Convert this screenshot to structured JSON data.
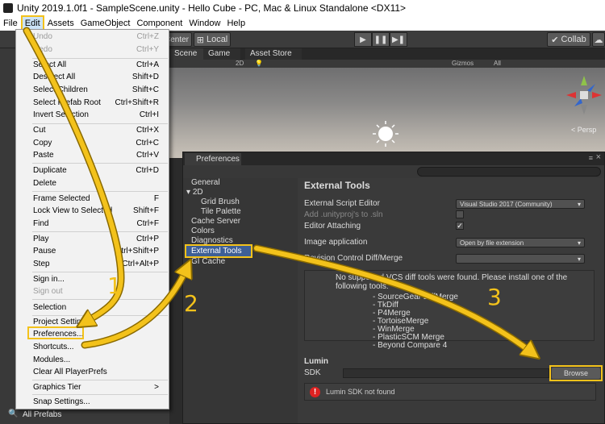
{
  "window": {
    "title": "Unity 2019.1.0f1 - SampleScene.unity - Hello Cube - PC, Mac & Linux Standalone <DX11>"
  },
  "menubar": [
    "File",
    "Edit",
    "Assets",
    "GameObject",
    "Component",
    "Window",
    "Help"
  ],
  "toolbar": {
    "center_label": "Center",
    "local_label": "Local",
    "collab_label": "Collab"
  },
  "scene_tabs": {
    "scene": "Scene",
    "game": "Game",
    "asset_store": "Asset Store"
  },
  "scene_options": {
    "mode": "2D",
    "gizmos": "Gizmos",
    "search": "All",
    "persp": "Persp"
  },
  "edit_menu": {
    "items": [
      {
        "label": "Undo",
        "shortcut": "Ctrl+Z",
        "disabled": true
      },
      {
        "label": "Redo",
        "shortcut": "Ctrl+Y",
        "disabled": true
      },
      {
        "label": "Select All",
        "shortcut": "Ctrl+A"
      },
      {
        "label": "Deselect All",
        "shortcut": "Shift+D"
      },
      {
        "label": "Select Children",
        "shortcut": "Shift+C"
      },
      {
        "label": "Select Prefab Root",
        "shortcut": "Ctrl+Shift+R"
      },
      {
        "label": "Invert Selection",
        "shortcut": "Ctrl+I"
      },
      {
        "label": "Cut",
        "shortcut": "Ctrl+X"
      },
      {
        "label": "Copy",
        "shortcut": "Ctrl+C"
      },
      {
        "label": "Paste",
        "shortcut": "Ctrl+V"
      },
      {
        "label": "Duplicate",
        "shortcut": "Ctrl+D"
      },
      {
        "label": "Delete",
        "shortcut": ""
      },
      {
        "label": "Frame Selected",
        "shortcut": "F"
      },
      {
        "label": "Lock View to Selected",
        "shortcut": "Shift+F"
      },
      {
        "label": "Find",
        "shortcut": "Ctrl+F"
      },
      {
        "label": "Play",
        "shortcut": "Ctrl+P"
      },
      {
        "label": "Pause",
        "shortcut": "Ctrl+Shift+P"
      },
      {
        "label": "Step",
        "shortcut": "Ctrl+Alt+P"
      },
      {
        "label": "Sign in...",
        "shortcut": ""
      },
      {
        "label": "Sign out",
        "shortcut": "",
        "disabled": true
      },
      {
        "label": "Selection",
        "shortcut": ""
      },
      {
        "label": "Project Settings...",
        "shortcut": ""
      },
      {
        "label": "Preferences...",
        "shortcut": ""
      },
      {
        "label": "Shortcuts...",
        "shortcut": ""
      },
      {
        "label": "Modules...",
        "shortcut": ""
      },
      {
        "label": "Clear All PlayerPrefs",
        "shortcut": ""
      },
      {
        "label": "Graphics Tier",
        "shortcut": ">"
      },
      {
        "label": "Snap Settings...",
        "shortcut": ""
      }
    ]
  },
  "preferences": {
    "tab": "Preferences",
    "sidebar": [
      "General",
      "2D",
      "Grid Brush",
      "Tile Palette",
      "Cache Server",
      "Colors",
      "Diagnostics",
      "External Tools",
      "GI Cache"
    ],
    "section_title": "External Tools",
    "rows": {
      "script_editor_label": "External Script Editor",
      "script_editor_value": "Visual Studio 2017 (Community)",
      "add_unityproj_label": "Add .unityproj's to .sln",
      "editor_attaching_label": "Editor Attaching",
      "image_app_label": "Image application",
      "image_app_value": "Open by file extension",
      "revision_label": "Revision Control Diff/Merge"
    },
    "vcs_message": "No supported VCS diff tools were found. Please install one of the following tools:",
    "vcs_tools": [
      "- SourceGear DiffMerge",
      "- TkDiff",
      "- P4Merge",
      "- TortoiseMerge",
      "- WinMerge",
      "- PlasticSCM Merge",
      "- Beyond Compare 4"
    ],
    "lumin_title": "Lumin",
    "sdk_label": "SDK",
    "browse_label": "Browse",
    "lumin_msg": "Lumin SDK not found"
  },
  "bottom": {
    "all_prefabs": "All Prefabs"
  },
  "callouts": [
    "1",
    "2",
    "3"
  ],
  "colors": {
    "highlight": "#f3c21b",
    "selection": "#3e5f96"
  }
}
